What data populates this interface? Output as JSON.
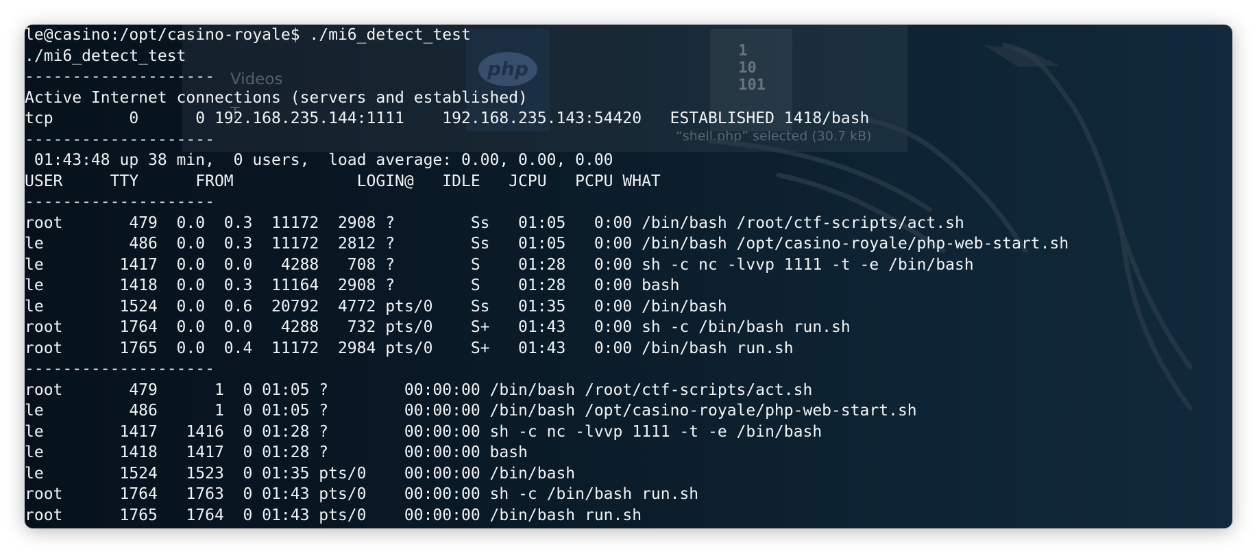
{
  "background": {
    "sidebar_item_videos": "Videos",
    "sidebar_item_trash": "T",
    "php_icon_label": "php",
    "binary_icon_text": " 1\n 10\n 101",
    "selection_caption": "“shell.php” selected  (30.7 kB)",
    "dragon_color": "#2b3b48"
  },
  "terminal": {
    "lines": [
      "le@casino:/opt/casino-royale$ ./mi6_detect_test",
      "./mi6_detect_test",
      "--------------------",
      "Active Internet connections (servers and established)",
      "tcp        0      0 192.168.235.144:1111    192.168.235.143:54420   ESTABLISHED 1418/bash",
      "--------------------",
      " 01:43:48 up 38 min,  0 users,  load average: 0.00, 0.00, 0.00",
      "USER     TTY      FROM             LOGIN@   IDLE   JCPU   PCPU WHAT",
      "--------------------",
      "root       479  0.0  0.3  11172  2908 ?        Ss   01:05   0:00 /bin/bash /root/ctf-scripts/act.sh",
      "le         486  0.0  0.3  11172  2812 ?        Ss   01:05   0:00 /bin/bash /opt/casino-royale/php-web-start.sh",
      "le        1417  0.0  0.0   4288   708 ?        S    01:28   0:00 sh -c nc -lvvp 1111 -t -e /bin/bash",
      "le        1418  0.0  0.3  11164  2908 ?        S    01:28   0:00 bash",
      "le        1524  0.0  0.6  20792  4772 pts/0    Ss   01:35   0:00 /bin/bash",
      "root      1764  0.0  0.0   4288   732 pts/0    S+   01:43   0:00 sh -c /bin/bash run.sh",
      "root      1765  0.0  0.4  11172  2984 pts/0    S+   01:43   0:00 /bin/bash run.sh",
      "--------------------",
      "root       479      1  0 01:05 ?        00:00:00 /bin/bash /root/ctf-scripts/act.sh",
      "le         486      1  0 01:05 ?        00:00:00 /bin/bash /opt/casino-royale/php-web-start.sh",
      "le        1417   1416  0 01:28 ?        00:00:00 sh -c nc -lvvp 1111 -t -e /bin/bash",
      "le        1418   1417  0 01:28 ?        00:00:00 bash",
      "le        1524   1523  0 01:35 pts/0    00:00:00 /bin/bash",
      "root      1764   1763  0 01:43 pts/0    00:00:00 sh -c /bin/bash run.sh",
      "root      1765   1764  0 01:43 pts/0    00:00:00 /bin/bash run.sh"
    ]
  }
}
